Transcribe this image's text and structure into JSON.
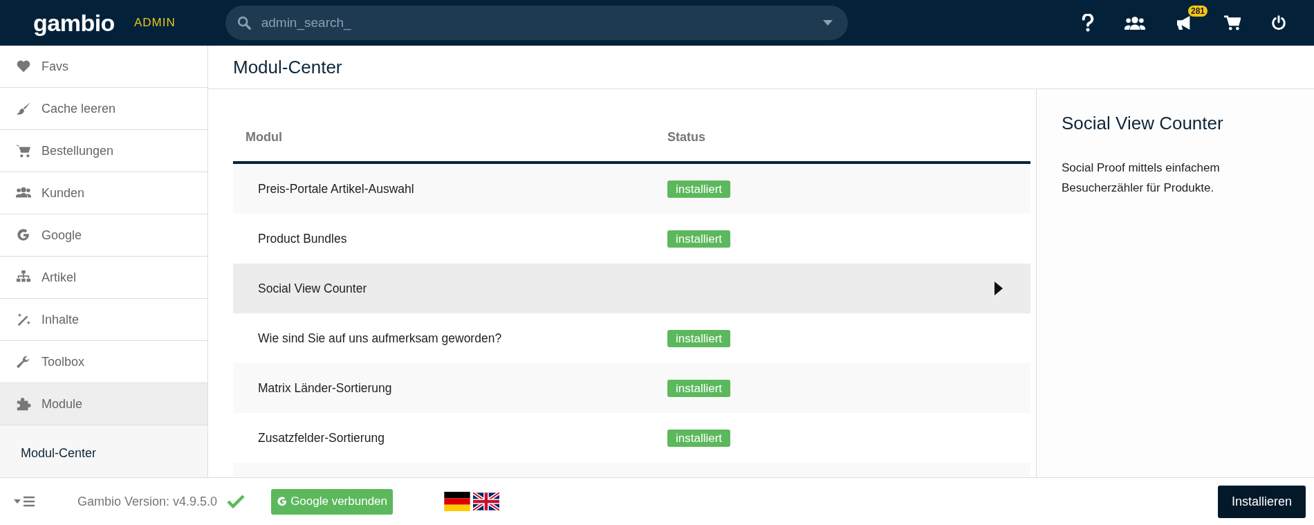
{
  "header": {
    "logo": "gambio",
    "logo_badge": "ADMIN",
    "search": {
      "placeholder": "admin_search_"
    },
    "notification_count": "281"
  },
  "sidebar": {
    "items": [
      {
        "label": "Favs",
        "selected": false
      },
      {
        "label": "Cache leeren",
        "selected": false
      },
      {
        "label": "Bestellungen",
        "selected": false
      },
      {
        "label": "Kunden",
        "selected": false
      },
      {
        "label": "Google",
        "selected": false
      },
      {
        "label": "Artikel",
        "selected": false
      },
      {
        "label": "Inhalte",
        "selected": false
      },
      {
        "label": "Toolbox",
        "selected": false
      },
      {
        "label": "Module",
        "selected": true
      }
    ],
    "submenu": [
      "Modul-Center"
    ]
  },
  "page_title": "Modul-Center",
  "table": {
    "columns": [
      "Modul",
      "Status"
    ],
    "rows": [
      {
        "name": "Preis-Portale Artikel-Auswahl",
        "status": "installiert",
        "selected": false
      },
      {
        "name": "Product Bundles",
        "status": "installiert",
        "selected": false
      },
      {
        "name": "Social View Counter",
        "selected": true
      },
      {
        "name": "Wie sind Sie auf uns aufmerksam geworden?",
        "status": "installiert",
        "selected": false
      },
      {
        "name": "Matrix Länder-Sortierung",
        "status": "installiert",
        "selected": false
      },
      {
        "name": "Zusatzfelder-Sortierung",
        "status": "installiert",
        "selected": false
      }
    ]
  },
  "detail": {
    "title": "Social View Counter",
    "description": "Social Proof mittels einfachem Besucherzähler für Produkte."
  },
  "footer": {
    "version": "Gambio Version: v4.9.5.0",
    "google_button": "Google verbunden",
    "install_button": "Installieren"
  }
}
